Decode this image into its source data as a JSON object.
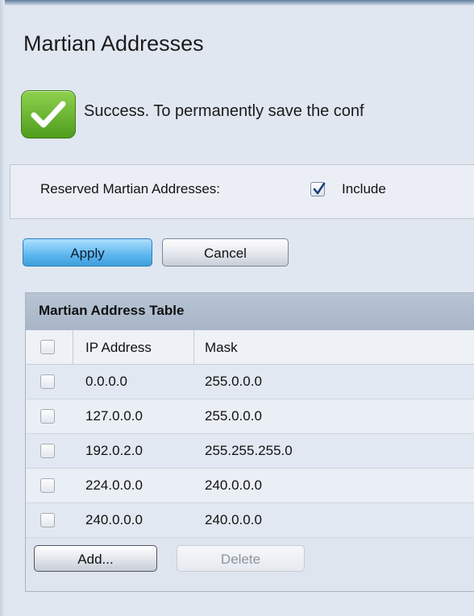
{
  "page": {
    "title": "Martian Addresses"
  },
  "status": {
    "message": "Success. To permanently save the conf",
    "icon": "check-icon",
    "icon_color": "#6cbd2e"
  },
  "reserved": {
    "label": "Reserved Martian Addresses:",
    "include_label": "Include",
    "include_checked": true
  },
  "actions": {
    "apply_label": "Apply",
    "cancel_label": "Cancel"
  },
  "table": {
    "caption": "Martian Address Table",
    "columns": [
      "IP Address",
      "Mask"
    ],
    "rows": [
      {
        "ip": "0.0.0.0",
        "mask": "255.0.0.0"
      },
      {
        "ip": "127.0.0.0",
        "mask": "255.0.0.0"
      },
      {
        "ip": "192.0.2.0",
        "mask": "255.255.255.0"
      },
      {
        "ip": "224.0.0.0",
        "mask": "240.0.0.0"
      },
      {
        "ip": "240.0.0.0",
        "mask": "240.0.0.0"
      }
    ],
    "add_label": "Add...",
    "delete_label": "Delete",
    "delete_enabled": false
  },
  "colors": {
    "accent": "#5cb6ee",
    "background": "#e1e7f1",
    "table_header": "#aab8c9"
  }
}
